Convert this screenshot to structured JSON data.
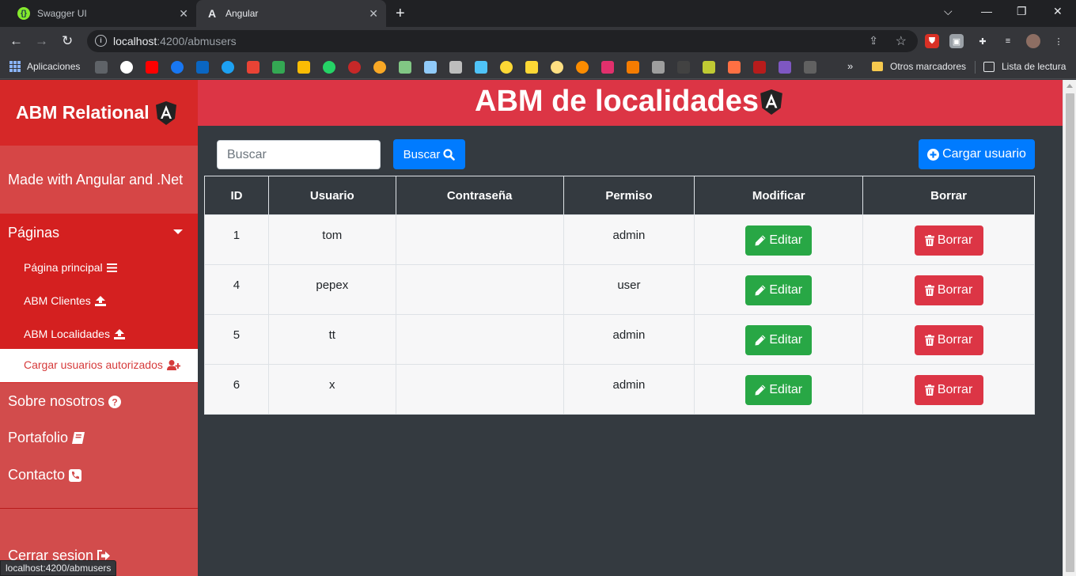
{
  "browser": {
    "tabs": [
      {
        "title": "Swagger UI",
        "icon": "swagger-icon"
      },
      {
        "title": "Angular",
        "icon": "angular-icon",
        "active": true
      }
    ],
    "url_host": "localhost",
    "url_path": ":4200/abmusers",
    "bookmarks": {
      "apps_label": "Aplicaciones",
      "other_label": "Otros marcadores",
      "reading_label": "Lista de lectura"
    },
    "status_url": "localhost:4200/abmusers"
  },
  "sidebar": {
    "brand": "ABM Relational",
    "tagline": "Made with Angular and .Net",
    "section_label": "Páginas",
    "sub_items": [
      {
        "label": "Página principal",
        "icon": "bars-icon"
      },
      {
        "label": "ABM Clientes",
        "icon": "upload-icon"
      },
      {
        "label": "ABM Localidades",
        "icon": "upload-icon"
      },
      {
        "label": "Cargar usuarios autorizados",
        "icon": "user-plus-icon",
        "active": true
      }
    ],
    "links": [
      {
        "label": "Sobre nosotros",
        "icon": "question-circle-icon"
      },
      {
        "label": "Portafolio",
        "icon": "book-icon"
      },
      {
        "label": "Contacto",
        "icon": "phone-icon"
      },
      {
        "label": "Cerrar sesion",
        "icon": "sign-out-icon"
      }
    ]
  },
  "main": {
    "title": "ABM de localidades",
    "search_placeholder": "Buscar",
    "search_button": "Buscar",
    "add_button": "Cargar usuario",
    "table": {
      "headers": [
        "ID",
        "Usuario",
        "Contraseña",
        "Permiso",
        "Modificar",
        "Borrar"
      ],
      "rows": [
        {
          "id": "1",
          "usuario": "tom",
          "contrasena": "",
          "permiso": "admin"
        },
        {
          "id": "4",
          "usuario": "pepex",
          "contrasena": "",
          "permiso": "user"
        },
        {
          "id": "5",
          "usuario": "tt",
          "contrasena": "",
          "permiso": "admin"
        },
        {
          "id": "6",
          "usuario": "x",
          "contrasena": "",
          "permiso": "admin"
        }
      ],
      "edit_label": "Editar",
      "delete_label": "Borrar"
    }
  },
  "colors": {
    "header_red": "#dc3545",
    "sidebar_red": "#d24c4c",
    "primary": "#007bff",
    "success": "#28a745",
    "danger": "#dc3545",
    "dark": "#343a40"
  }
}
